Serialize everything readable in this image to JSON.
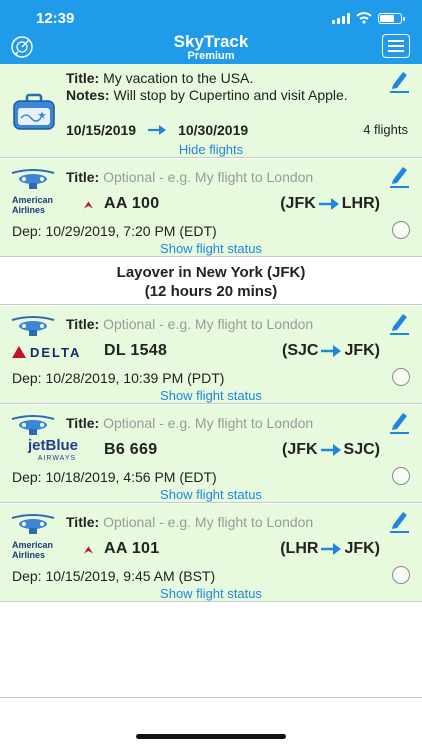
{
  "status_bar": {
    "time": "12:39"
  },
  "header": {
    "title": "SkyTrack",
    "subtitle": "Premium"
  },
  "trip": {
    "title_label": "Title:",
    "title_value": "My vacation to the USA.",
    "notes_label": "Notes:",
    "notes_value": "Will stop by Cupertino and visit Apple.",
    "start_date": "10/15/2019",
    "end_date": "10/30/2019",
    "flight_count": "4 flights",
    "hide_link": "Hide flights"
  },
  "layover": {
    "line1": "Layover in New York (JFK)",
    "line2": "(12 hours 20 mins)"
  },
  "flights": [
    {
      "title_label": "Title:",
      "title_placeholder": "Optional - e.g. My flight to London",
      "airline": "American Airlines",
      "flight_number": "AA 100",
      "from": "(JFK",
      "to": "LHR)",
      "departure": "Dep: 10/29/2019, 7:20 PM (EDT)",
      "status_link": "Show flight status"
    },
    {
      "title_label": "Title:",
      "title_placeholder": "Optional - e.g. My flight to London",
      "airline": "DELTA",
      "flight_number": "DL 1548",
      "from": "(SJC",
      "to": "JFK)",
      "departure": "Dep: 10/28/2019, 10:39 PM (PDT)",
      "status_link": "Show flight status"
    },
    {
      "title_label": "Title:",
      "title_placeholder": "Optional - e.g. My flight to London",
      "airline": "jetBlue",
      "airline_sub": "AIRWAYS",
      "flight_number": "B6 669",
      "from": "(JFK",
      "to": "SJC)",
      "departure": "Dep: 10/18/2019, 4:56 PM (EDT)",
      "status_link": "Show flight status"
    },
    {
      "title_label": "Title:",
      "title_placeholder": "Optional - e.g. My flight to London",
      "airline": "American Airlines",
      "flight_number": "AA 101",
      "from": "(LHR",
      "to": "JFK)",
      "departure": "Dep: 10/15/2019, 9:45 AM (BST)",
      "status_link": "Show flight status"
    }
  ],
  "colors": {
    "header": "#1f9bea",
    "card": "#e7fadd",
    "link": "#1f86e0",
    "arrow": "#1f86e0"
  },
  "icons": [
    "radar-icon",
    "menu-icon",
    "suitcase-icon",
    "edit-icon",
    "plane-icon",
    "arrow-right-icon",
    "radio-icon"
  ]
}
